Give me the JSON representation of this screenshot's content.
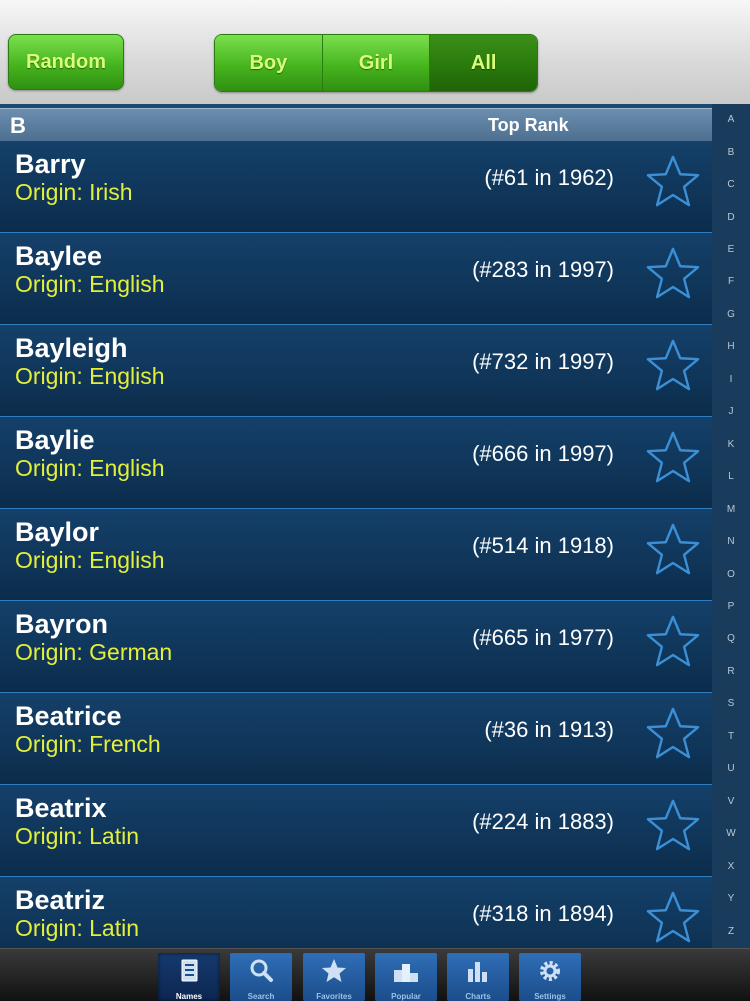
{
  "toolbar": {
    "random_label": "Random",
    "segments": [
      {
        "label": "Boy"
      },
      {
        "label": "Girl"
      },
      {
        "label": "All",
        "selected": true
      }
    ]
  },
  "section": {
    "letter": "B",
    "rank_header": "Top Rank"
  },
  "names": [
    {
      "name": "Barry",
      "origin": "Origin: Irish",
      "rank": "(#61 in 1962)"
    },
    {
      "name": "Baylee",
      "origin": "Origin: English",
      "rank": "(#283 in 1997)"
    },
    {
      "name": "Bayleigh",
      "origin": "Origin: English",
      "rank": "(#732 in 1997)"
    },
    {
      "name": "Baylie",
      "origin": "Origin: English",
      "rank": "(#666 in 1997)"
    },
    {
      "name": "Baylor",
      "origin": "Origin: English",
      "rank": "(#514 in 1918)"
    },
    {
      "name": "Bayron",
      "origin": "Origin: German",
      "rank": "(#665 in 1977)"
    },
    {
      "name": "Beatrice",
      "origin": "Origin: French",
      "rank": "(#36 in 1913)"
    },
    {
      "name": "Beatrix",
      "origin": "Origin: Latin",
      "rank": "(#224 in 1883)"
    },
    {
      "name": "Beatriz",
      "origin": "Origin: Latin",
      "rank": "(#318 in 1894)"
    }
  ],
  "index_letters": [
    "A",
    "B",
    "C",
    "D",
    "E",
    "F",
    "G",
    "H",
    "I",
    "J",
    "K",
    "L",
    "M",
    "N",
    "O",
    "P",
    "Q",
    "R",
    "S",
    "T",
    "U",
    "V",
    "W",
    "X",
    "Y",
    "Z"
  ],
  "tabs": [
    {
      "label": "Names",
      "icon": "names-icon",
      "active": true
    },
    {
      "label": "Search",
      "icon": "search-icon"
    },
    {
      "label": "Favorites",
      "icon": "star-icon"
    },
    {
      "label": "Popular",
      "icon": "podium-icon"
    },
    {
      "label": "Charts",
      "icon": "bar-chart-icon"
    },
    {
      "label": "Settings",
      "icon": "gear-icon"
    }
  ],
  "colors": {
    "origin_text": "#e4ef3a",
    "button_green": "#47b51e",
    "tab_blue": "#2f6eb7"
  }
}
